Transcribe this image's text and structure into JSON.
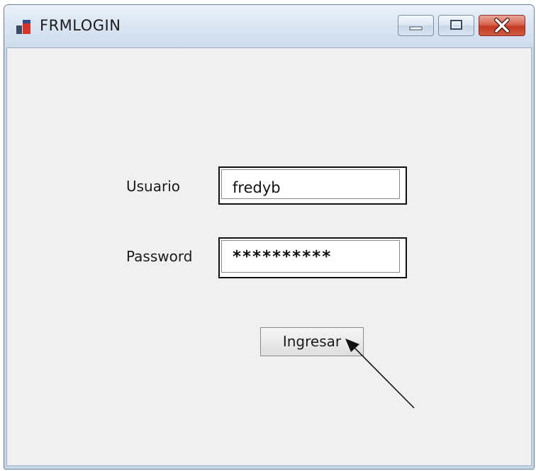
{
  "window": {
    "title": "FRMLOGIN",
    "controls": {
      "minimize_icon": "minimize-icon",
      "maximize_icon": "maximize-icon",
      "close_icon": "close-icon"
    }
  },
  "form": {
    "usuario_label": "Usuario",
    "usuario_value": "fredyb",
    "password_label": "Password",
    "password_value": "**********",
    "submit_label": "Ingresar"
  },
  "annotation": {
    "icon": "arrow-pointer-icon"
  },
  "colors": {
    "close_button": "#c23a22",
    "client_background": "#f0f0f0",
    "titlebar": "#dbe6f3"
  }
}
